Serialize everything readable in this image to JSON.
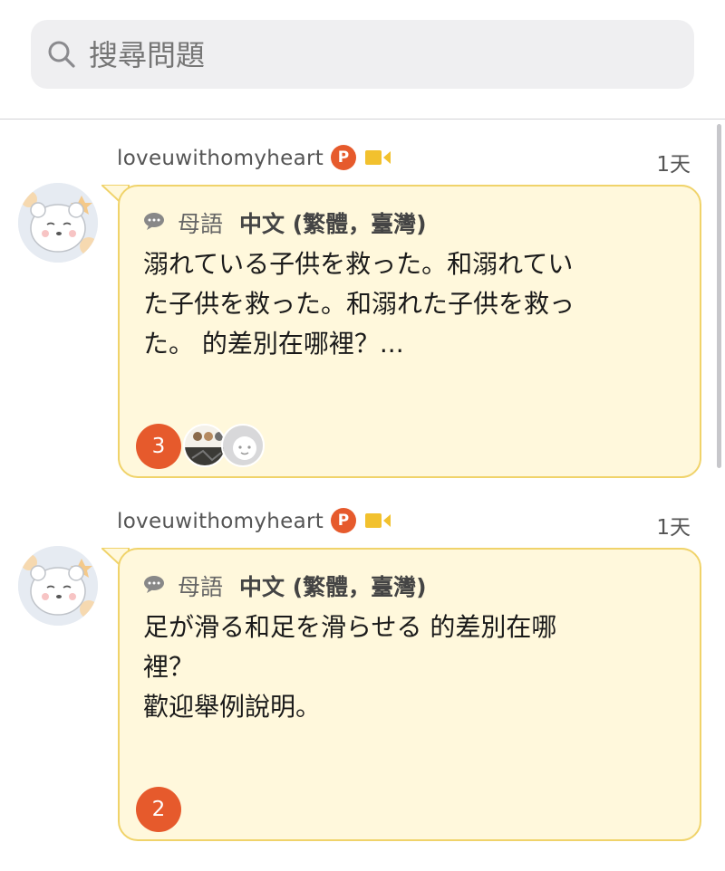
{
  "search": {
    "placeholder": "搜尋問題"
  },
  "questions": [
    {
      "username": "loveuwithomyheart",
      "badge": "P",
      "time": "1天",
      "language_label": "母語",
      "language_value": "中文 (繁體，臺灣)",
      "text": "溺れている子供を救った。和溺れてい\nた子供を救った。和溺れた子供を救っ\nた。 的差別在哪裡？...",
      "answer_count": "3"
    },
    {
      "username": "loveuwithomyheart",
      "badge": "P",
      "time": "1天",
      "language_label": "母語",
      "language_value": "中文 (繁體，臺灣)",
      "text": "足が滑る和足を滑らせる 的差別在哪\n裡？\n歡迎舉例說明。",
      "answer_count": "2"
    }
  ],
  "colors": {
    "accent": "#e65a2c",
    "bubble_bg": "#fff8dc",
    "bubble_border": "#f0d36a",
    "camera": "#f2c12e"
  }
}
